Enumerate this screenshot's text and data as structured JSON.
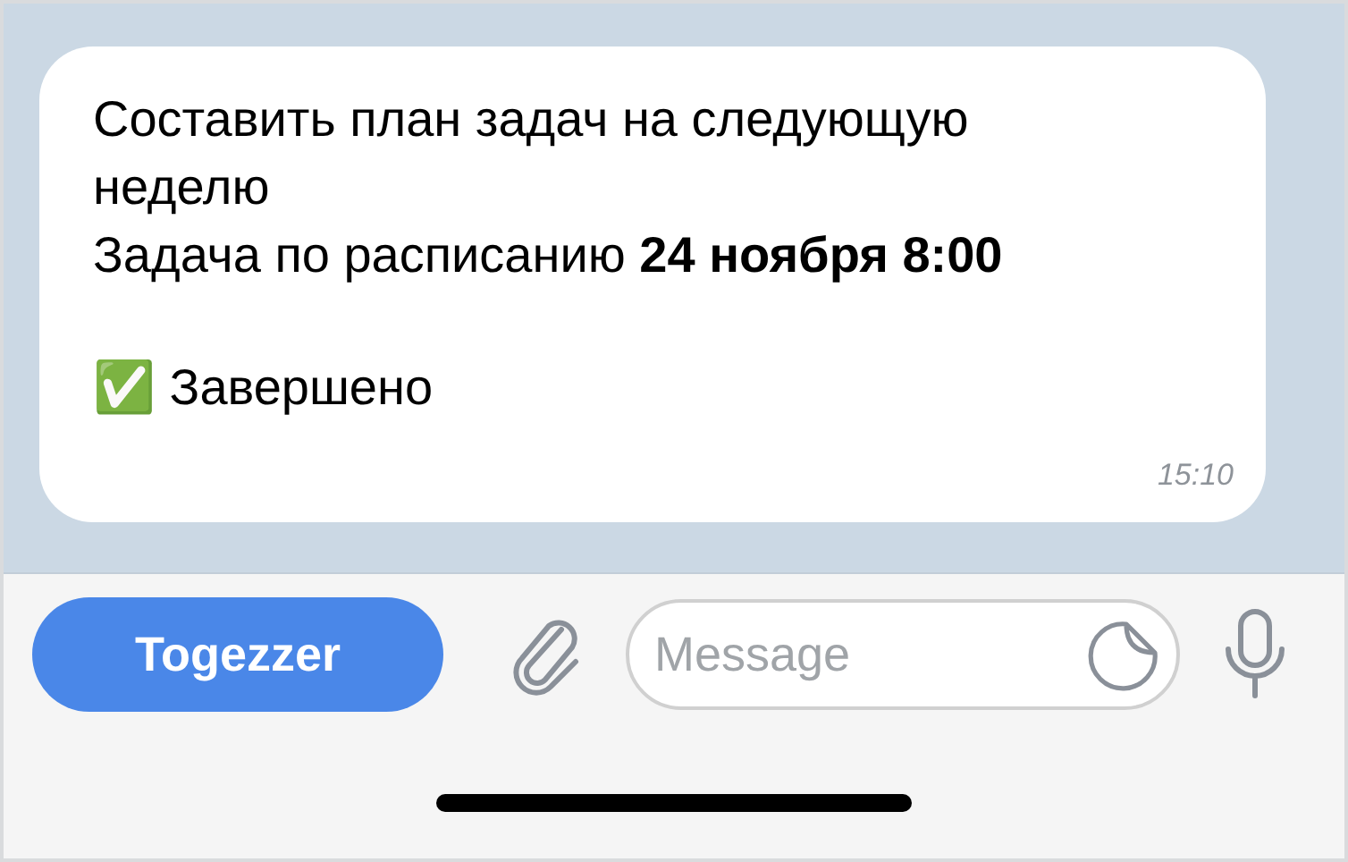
{
  "message": {
    "lines": [
      "Составить план задач на следующую неделю",
      "Задача по расписанию **24 ноября 8:00**",
      "✅ Завершено"
    ],
    "time": "15:10"
  },
  "composer": {
    "button": "Togezzer",
    "placeholder": "Message"
  }
}
